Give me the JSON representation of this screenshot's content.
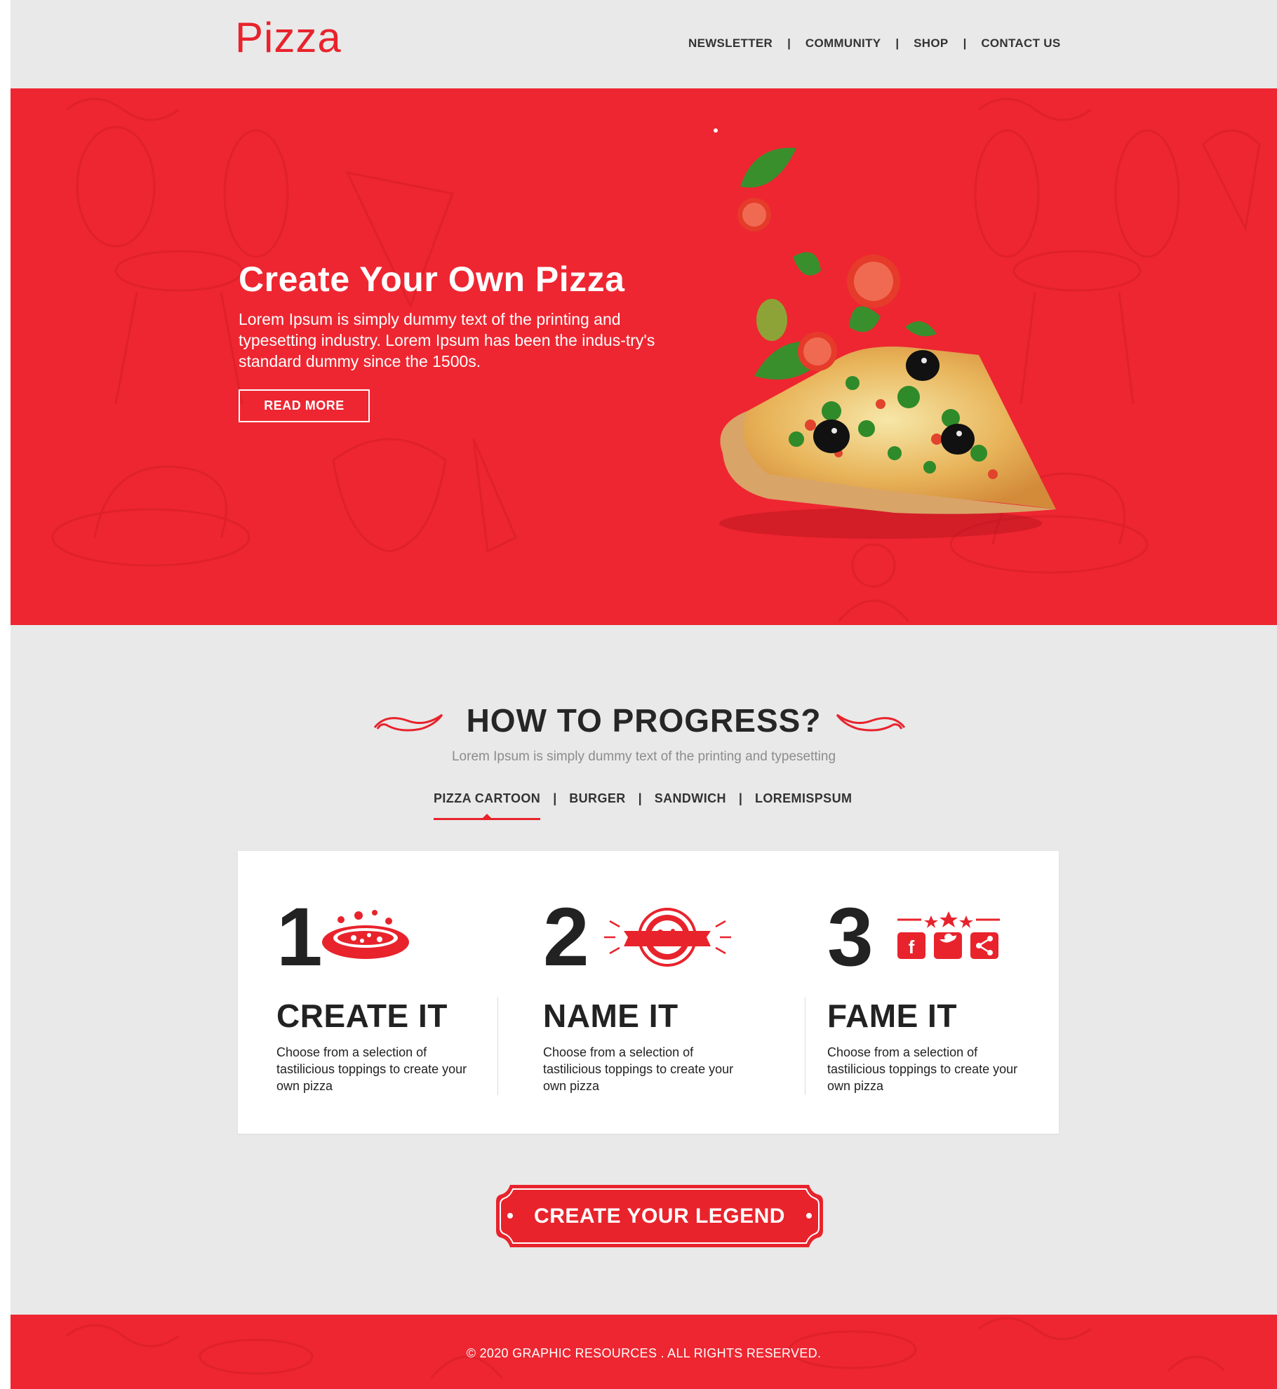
{
  "header": {
    "logo": "Pizza",
    "nav": [
      "NEWSLETTER",
      "COMMUNITY",
      "SHOP",
      "CONTACT US"
    ],
    "separator": "|"
  },
  "hero": {
    "title": "Create Your Own Pizza",
    "body": "Lorem Ipsum is simply dummy text of the printing and typesetting industry. Lorem Ipsum has been the indus-try's standard dummy since the 1500s.",
    "button": "READ MORE"
  },
  "progress": {
    "title": "HOW TO PROGRESS?",
    "subtitle": "Lorem Ipsum is simply dummy text of the printing and typesetting",
    "tabs": [
      "PIZZA CARTOON",
      "BURGER",
      "SANDWICH",
      "LOREMISPSUM"
    ],
    "active_tab": "PIZZA CARTOON",
    "steps": [
      {
        "number": "1",
        "title": "CREATE IT",
        "text": "Choose from a selection of tastilicious toppings to create your own pizza",
        "icon": "pizza-icon"
      },
      {
        "number": "2",
        "title": "NAME IT",
        "text": "Choose from a selection of tastilicious toppings to create your own pizza",
        "icon": "pizza-badge-icon"
      },
      {
        "number": "3",
        "title": "FAME IT",
        "text": "Choose from a selection of tastilicious toppings to create your own pizza",
        "icon": "social-share-icon"
      }
    ],
    "cta": "CREATE YOUR LEGEND"
  },
  "footer": {
    "text": "© 2020 GRAPHIC RESOURCES . ALL RIGHTS RESERVED."
  },
  "colors": {
    "brand_red": "#ee2631",
    "logo_red": "#e8232c",
    "background": "#e9e9e9",
    "dark_text": "#222222"
  }
}
